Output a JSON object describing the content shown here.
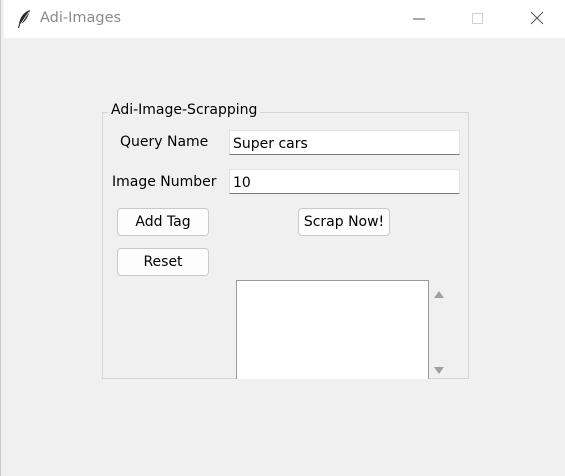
{
  "window": {
    "title": "Adi-Images"
  },
  "icons": {
    "app": "feather-icon",
    "minimize": "minimize-icon",
    "maximize": "maximize-icon",
    "close": "close-icon",
    "scroll_up": "triangle-up-icon",
    "scroll_down": "triangle-down-icon"
  },
  "form": {
    "group_title": "Adi-Image-Scrapping",
    "query_label": "Query Name",
    "query_value": "Super cars",
    "number_label": "Image Number",
    "number_value": "10",
    "add_tag_label": "Add Tag",
    "scrap_now_label": "Scrap Now!",
    "reset_label": "Reset"
  },
  "colors": {
    "window_bg": "#f0f0f0",
    "titlebar_bg": "#ffffff",
    "title_text": "#8a8a8a",
    "scroll_arrow": "#a0a0a0"
  }
}
